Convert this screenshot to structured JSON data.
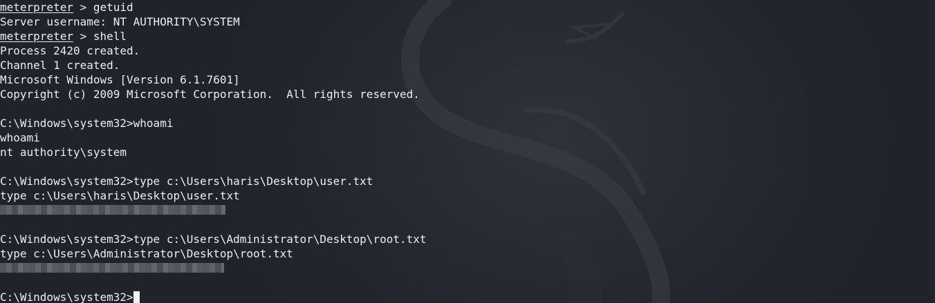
{
  "terminal": {
    "lines": [
      {
        "prompt": "meterpreter",
        "text": " > getuid"
      },
      {
        "text": "Server username: NT AUTHORITY\\SYSTEM"
      },
      {
        "prompt": "meterpreter",
        "text": " > shell"
      },
      {
        "text": "Process 2420 created."
      },
      {
        "text": "Channel 1 created."
      },
      {
        "text": "Microsoft Windows [Version 6.1.7601]"
      },
      {
        "text": "Copyright (c) 2009 Microsoft Corporation.  All rights reserved."
      },
      {
        "text": ""
      },
      {
        "text": "C:\\Windows\\system32>whoami"
      },
      {
        "text": "whoami"
      },
      {
        "text": "nt authority\\system"
      },
      {
        "text": ""
      },
      {
        "text": "C:\\Windows\\system32>type c:\\Users\\haris\\Desktop\\user.txt"
      },
      {
        "text": "type c:\\Users\\haris\\Desktop\\user.txt"
      },
      {
        "redacted": true
      },
      {
        "text": ""
      },
      {
        "text": "C:\\Windows\\system32>type c:\\Users\\Administrator\\Desktop\\root.txt"
      },
      {
        "text": "type c:\\Users\\Administrator\\Desktop\\root.txt"
      },
      {
        "redacted": true
      },
      {
        "text": ""
      },
      {
        "text": "C:\\Windows\\system32>",
        "cursor": true
      }
    ]
  },
  "colors": {
    "background": "#23262e",
    "foreground": "#eceff1",
    "cursor": "#f2f2f2"
  },
  "icons": {
    "wallpaper": "kali-dragon-icon"
  }
}
